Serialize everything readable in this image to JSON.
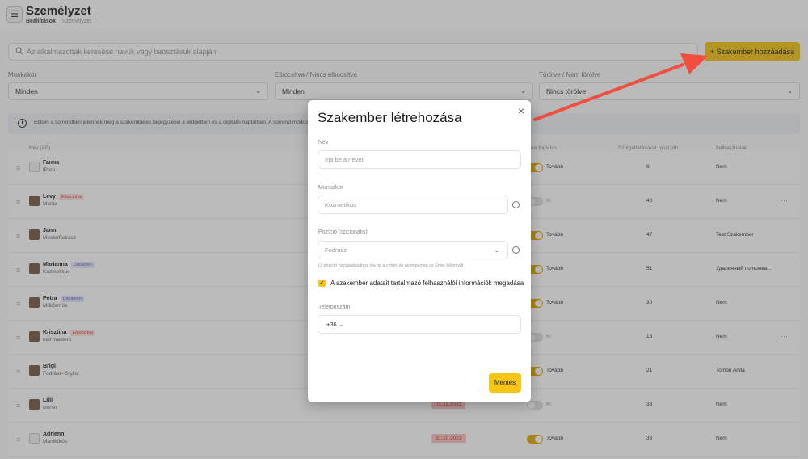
{
  "header": {
    "menu_icon": "☰",
    "title": "Személyzet",
    "breadcrumb_first": "Beállítások",
    "breadcrumb_second": "Személyzet"
  },
  "search": {
    "icon": "search-icon",
    "placeholder": "Az alkalmazottak keresése nevük vagy beosztásuk alapján"
  },
  "add_button": "+  Szakember hozzáadása",
  "filters": [
    {
      "label": "Munkakör",
      "value": "Minden"
    },
    {
      "label": "Elbocsítva / Nincs elbocsítva",
      "value": "Minden"
    },
    {
      "label": "Törölve / Nem törölve",
      "value": "Nincs törölve"
    }
  ],
  "info_bar": {
    "text": "Ebben a sorrendben jelennek meg a szakemberek bejegyzései a widgetben és a digitális naptárban. A sorrend módosításá"
  },
  "table": {
    "headers": {
      "name": "Név (ÁÉ)",
      "booking": "ekre foglalás",
      "count": "Szolgáltatásokat nyújt, db.",
      "user": "Felhasználók"
    },
    "rows": [
      {
        "name": "Ганна",
        "sub": "iPoro",
        "tag": "",
        "tag_color": "",
        "booking": "Tovább",
        "booking_on": true,
        "count": "6",
        "user": "Nem",
        "date": ""
      },
      {
        "name": "Levy",
        "sub": "Mania",
        "tag": "Elbocsítva",
        "tag_color": "red",
        "booking": "Ki",
        "booking_on": false,
        "count": "48",
        "user": "Nem",
        "date": ""
      },
      {
        "name": "Janni",
        "sub": "Mesterfodrász",
        "tag": "",
        "tag_color": "",
        "booking": "Tovább",
        "booking_on": true,
        "count": "47",
        "user": "Test Szakember",
        "date": ""
      },
      {
        "name": "Marianna",
        "sub": "Kozmetikus",
        "tag": "Üdülésen",
        "tag_color": "purple",
        "booking": "Tovább",
        "booking_on": true,
        "count": "51",
        "user": "Удаленный пользова...",
        "date": ""
      },
      {
        "name": "Petra",
        "sub": "Műkörmös",
        "tag": "Üdülésen",
        "tag_color": "purple",
        "booking": "Tovább",
        "booking_on": true,
        "count": "30",
        "user": "Nem",
        "date": ""
      },
      {
        "name": "Krisztina",
        "sub": "nail masterp",
        "tag": "Elbocsítva",
        "tag_color": "red",
        "booking": "Ki",
        "booking_on": false,
        "count": "13",
        "user": "Nem",
        "date": ""
      },
      {
        "name": "Brigi",
        "sub": "Fodrász- Stylist",
        "tag": "",
        "tag_color": "",
        "booking": "Tovább",
        "booking_on": true,
        "count": "21",
        "user": "Tomori Anita",
        "date": ""
      },
      {
        "name": "Lilli",
        "sub": "owner",
        "tag": "",
        "tag_color": "",
        "booking": "Ki",
        "booking_on": false,
        "count": "33",
        "user": "Nem",
        "date": "01.11.2023"
      },
      {
        "name": "Adrienn",
        "sub": "Manikűrös",
        "tag": "",
        "tag_color": "",
        "booking": "Tovább",
        "booking_on": true,
        "count": "38",
        "user": "Nem",
        "date": "31.10.2023"
      }
    ]
  },
  "modal": {
    "title": "Szakember létrehozása",
    "close_icon": "×",
    "name_label": "Név",
    "name_placeholder": "Írja be a nevet",
    "role_label": "Munkakör",
    "role_value": "Kozmetikus",
    "position_label": "Pozíció (opcionális)",
    "position_value": "Fodrász",
    "position_hint": "Új pozíció hozzáadásához írja be a címet, és nyomja meg az Enter billentyűt",
    "checkbox_checked": true,
    "checkbox_label": "A szakember adatait tartalmazó felhasználói információk megadása",
    "phone_label": "Telefonszám",
    "phone_code": "+36",
    "save_button": "Mentés"
  },
  "colors": {
    "accent": "#f5c518",
    "arrow": "#f04e3e",
    "overlay": "rgba(60,60,60,0.35)"
  }
}
